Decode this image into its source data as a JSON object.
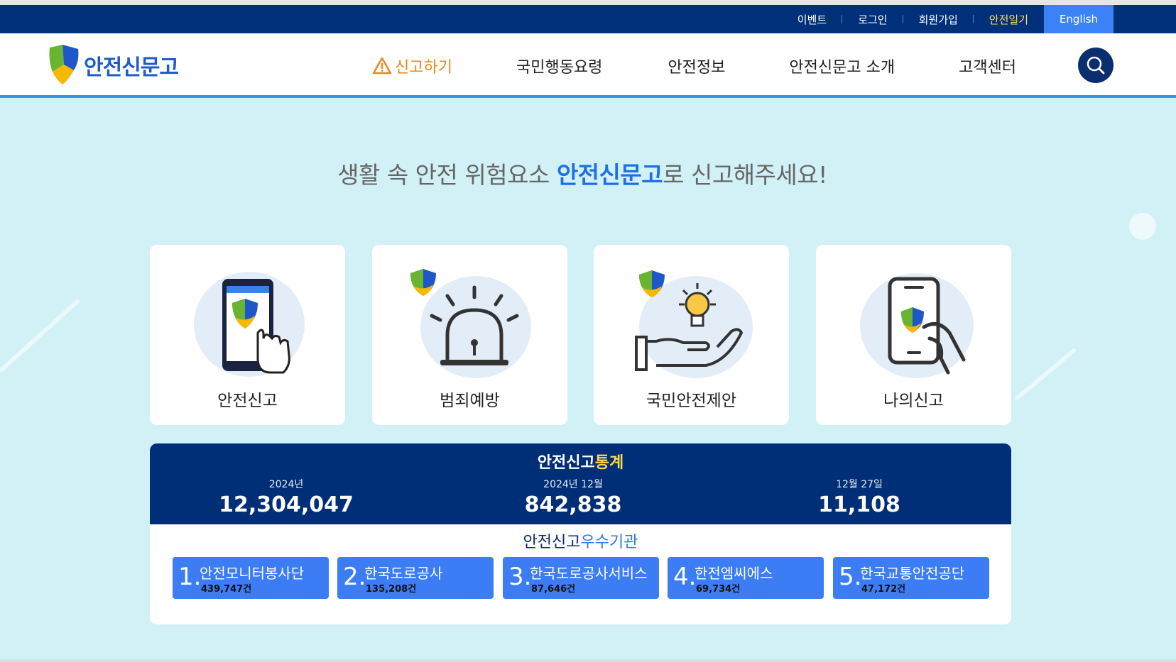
{
  "topbar": {
    "links": [
      "이벤트",
      "로그인",
      "회원가입",
      "안전일기"
    ],
    "english": "English"
  },
  "header": {
    "logo_text": "안전신문고",
    "nav": [
      "신고하기",
      "국민행동요령",
      "안전정보",
      "안전신문고 소개",
      "고객센터"
    ],
    "search_icon": "search-icon",
    "report_icon": "warning-icon"
  },
  "headline": {
    "pre": "생활 속 안전 위험요소 ",
    "highlight": "안전신문고",
    "post": "로 신고해주세요!"
  },
  "cards": [
    {
      "label": "안전신고",
      "icon": "phone-touch-icon"
    },
    {
      "label": "범죄예방",
      "icon": "siren-icon"
    },
    {
      "label": "국민안전제안",
      "icon": "idea-hand-icon"
    },
    {
      "label": "나의신고",
      "icon": "phone-hand-icon"
    }
  ],
  "stats": {
    "title_a": "안전신고",
    "title_b": "통계",
    "items": [
      {
        "caption": "2024년",
        "value": "12,304,047"
      },
      {
        "caption": "2024년 12월",
        "value": "842,838"
      },
      {
        "caption": "12월 27일",
        "value": "11,108"
      }
    ],
    "orgs_title_a": "안전신고",
    "orgs_title_b": "우수기관",
    "orgs": [
      {
        "rank": "1.",
        "name": "안전모니터봉사단",
        "count": "439,747건"
      },
      {
        "rank": "2.",
        "name": "한국도로공사",
        "count": "135,208건"
      },
      {
        "rank": "3.",
        "name": "한국도로공사서비스",
        "count": "87,646건"
      },
      {
        "rank": "4.",
        "name": "한전엠씨에스",
        "count": "69,734건"
      },
      {
        "rank": "5.",
        "name": "한국교통안전공단",
        "count": "47,172건"
      }
    ]
  },
  "colors": {
    "navy": "#003079",
    "accent_blue": "#3a82f5",
    "highlight_yellow": "#ffe14a",
    "report_orange": "#e68a1a",
    "background": "#d2f1f7"
  }
}
